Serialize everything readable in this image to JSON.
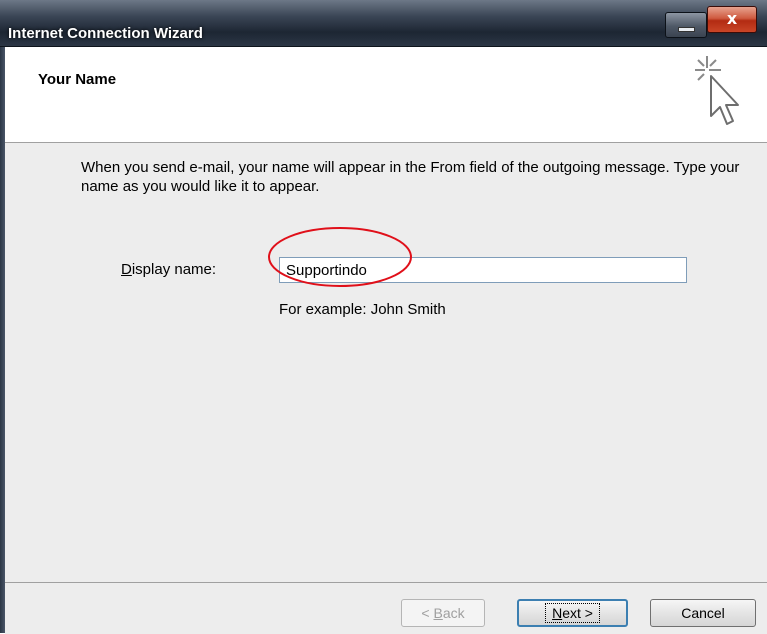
{
  "window": {
    "title": "Internet Connection Wizard",
    "close_glyph": "x"
  },
  "header": {
    "title": "Your Name",
    "icon": "wizard-cursor-icon"
  },
  "content": {
    "description": "When you send e-mail, your name will appear in the From field of the outgoing message. Type your name as you would like it to appear.",
    "display_name_label": "Display name:",
    "display_name_value": "Supportindo",
    "hint": "For example: John Smith"
  },
  "buttons": {
    "back": "< Back",
    "next": "Next >",
    "cancel": "Cancel"
  },
  "colors": {
    "annotation": "#e0101a",
    "default_button_border": "#3c7fb1"
  }
}
